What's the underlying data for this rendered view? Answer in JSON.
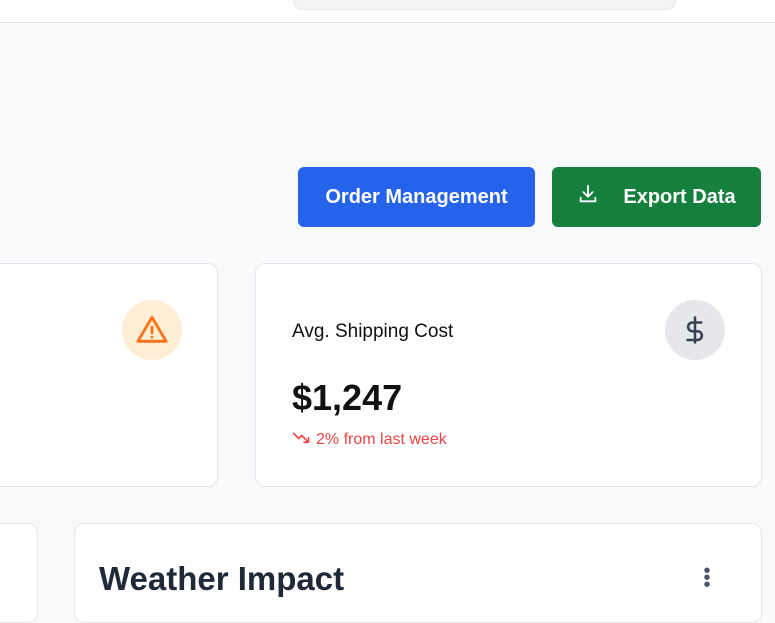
{
  "toolbar": {
    "order_management": "Order Management",
    "export_data": "Export Data"
  },
  "cards": [
    {
      "label": "Avg. Shipping Cost",
      "value": "$1,247",
      "trend": "2% from last week"
    }
  ],
  "panels": {
    "weather_title": "Weather Impact"
  },
  "colors": {
    "primary": "#2563eb",
    "success": "#15803d",
    "danger": "#ef4444",
    "warning": "#f97316"
  }
}
